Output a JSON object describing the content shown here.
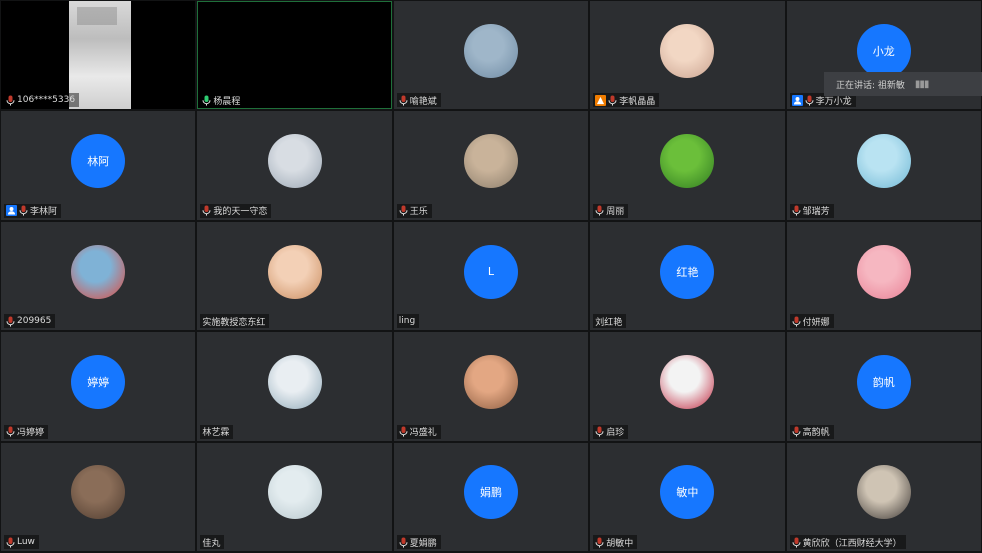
{
  "colors": {
    "avatar_blue": "#1677ff",
    "mic_normal": "#c0392b",
    "mic_speaking": "#2ecc71",
    "host_badge": "#1677ff",
    "cohost_badge": "#f07c00"
  },
  "tiles": [
    {
      "kind": "video",
      "name": "106****5336",
      "mic": "mic-icon"
    },
    {
      "kind": "video-active",
      "name": "杨晨程",
      "mic": "mic-speaking-icon"
    },
    {
      "kind": "image",
      "name": "喻艳斌",
      "mic": "mic-icon",
      "avatar_colors": [
        "#9fb6c9",
        "#6e8aa3"
      ]
    },
    {
      "kind": "image",
      "name": "李帆晶晶",
      "mic": "mic-icon",
      "badge": "cohost",
      "avatar_colors": [
        "#f2d7c4",
        "#c9a28f"
      ]
    },
    {
      "kind": "text",
      "name": "李万小龙",
      "mic": "mic-icon",
      "badge": "host",
      "avatar_text": "小龙"
    },
    {
      "kind": "text",
      "name": "李林阿",
      "mic": "mic-icon",
      "badge": "host",
      "avatar_text": "林阿"
    },
    {
      "kind": "image",
      "name": "我的天一守恋",
      "mic": "mic-icon",
      "avatar_colors": [
        "#d8dde3",
        "#9aa6b3"
      ]
    },
    {
      "kind": "image",
      "name": "王乐",
      "mic": "mic-icon",
      "avatar_colors": [
        "#c9b39a",
        "#8a7c6a"
      ]
    },
    {
      "kind": "image",
      "name": "周丽",
      "mic": "mic-icon",
      "avatar_colors": [
        "#6bbf3a",
        "#2f7a21"
      ]
    },
    {
      "kind": "image",
      "name": "邹瑞芳",
      "mic": "mic-icon",
      "avatar_colors": [
        "#b9e3f2",
        "#6fb7d4"
      ]
    },
    {
      "kind": "image",
      "name": "209965",
      "mic": "mic-icon",
      "avatar_colors": [
        "#7fb2d6",
        "#e2473a"
      ]
    },
    {
      "kind": "image",
      "name": "实施教授恋东红",
      "mic": "",
      "avatar_colors": [
        "#f3d0b6",
        "#c98b5d"
      ]
    },
    {
      "kind": "text",
      "name": "ling",
      "mic": "",
      "avatar_text": "L"
    },
    {
      "kind": "text",
      "name": "刘红艳",
      "mic": "",
      "avatar_text": "红艳"
    },
    {
      "kind": "image",
      "name": "付妍娜",
      "mic": "mic-icon",
      "avatar_colors": [
        "#f6b7c1",
        "#e87f94"
      ]
    },
    {
      "kind": "text",
      "name": "冯婷婷",
      "mic": "mic-icon",
      "avatar_text": "婷婷"
    },
    {
      "kind": "image",
      "name": "林艺霖",
      "mic": "",
      "avatar_colors": [
        "#e9eef2",
        "#8fa9b8"
      ]
    },
    {
      "kind": "image",
      "name": "冯盛礼",
      "mic": "mic-icon",
      "avatar_colors": [
        "#e3a783",
        "#8a5b3f"
      ]
    },
    {
      "kind": "image",
      "name": "启珍",
      "mic": "mic-icon",
      "avatar_colors": [
        "#f3f3f3",
        "#c0233b"
      ]
    },
    {
      "kind": "text",
      "name": "高韵帆",
      "mic": "mic-icon",
      "avatar_text": "韵帆"
    },
    {
      "kind": "image",
      "name": "Luw",
      "mic": "mic-icon",
      "avatar_colors": [
        "#8a6d58",
        "#4e3b2f"
      ]
    },
    {
      "kind": "image",
      "name": "佳丸",
      "mic": "",
      "avatar_colors": [
        "#e3ecef",
        "#b7c7cd"
      ]
    },
    {
      "kind": "text",
      "name": "夏娟鹏",
      "mic": "mic-icon",
      "avatar_text": "娟鹏"
    },
    {
      "kind": "text",
      "name": "胡敏中",
      "mic": "mic-icon",
      "avatar_text": "敏中"
    },
    {
      "kind": "image",
      "name": "黄欣欣（江西财经大学）",
      "mic": "mic-icon",
      "avatar_colors": [
        "#cfc4b4",
        "#3b3633"
      ]
    }
  ],
  "popup": {
    "text": "正在讲话: 祖新敏",
    "bars": "▮▮▮"
  }
}
